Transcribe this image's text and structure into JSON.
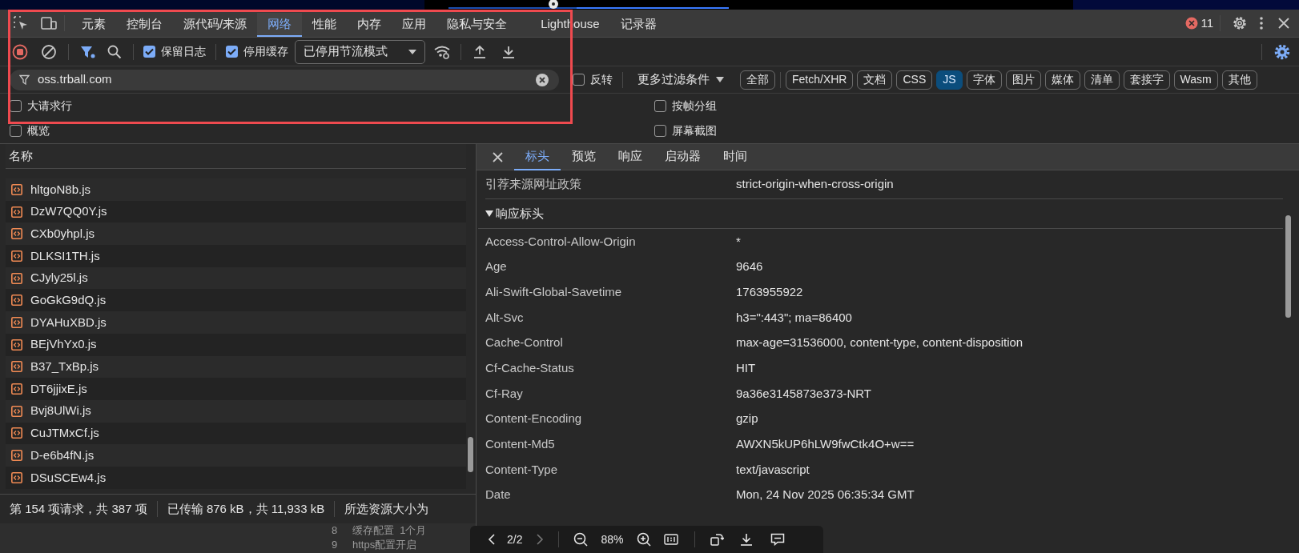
{
  "devtools_tabs": [
    {
      "label": "元素",
      "selected": false
    },
    {
      "label": "控制台",
      "selected": false
    },
    {
      "label": "源代码/来源",
      "selected": false
    },
    {
      "label": "网络",
      "selected": true
    },
    {
      "label": "性能",
      "selected": false
    },
    {
      "label": "内存",
      "selected": false
    },
    {
      "label": "应用",
      "selected": false
    },
    {
      "label": "隐私与安全",
      "selected": false
    },
    {
      "label": "Lighthouse",
      "selected": false
    },
    {
      "label": "记录器",
      "selected": false
    }
  ],
  "error_count": "11",
  "toolbar": {
    "recording": true,
    "checkboxes": [
      {
        "label": "保留日志",
        "checked": true
      },
      {
        "label": "停用缓存",
        "checked": true
      }
    ],
    "throttling": "已停用节流模式"
  },
  "filter": {
    "value": "oss.trball.com"
  },
  "invert": {
    "label": "反转",
    "checked": false
  },
  "more_filters": "更多过滤条件",
  "type_chips": [
    {
      "label": "全部",
      "selected": false
    },
    {
      "label": "Fetch/XHR",
      "selected": false
    },
    {
      "label": "文档",
      "selected": false
    },
    {
      "label": "CSS",
      "selected": false
    },
    {
      "label": "JS",
      "selected": true
    },
    {
      "label": "字体",
      "selected": false
    },
    {
      "label": "图片",
      "selected": false
    },
    {
      "label": "媒体",
      "selected": false
    },
    {
      "label": "清单",
      "selected": false
    },
    {
      "label": "套接字",
      "selected": false
    },
    {
      "label": "Wasm",
      "selected": false
    },
    {
      "label": "其他",
      "selected": false
    }
  ],
  "options": [
    {
      "label": "大请求行",
      "checked": false
    },
    {
      "label": "按帧分组",
      "checked": false
    },
    {
      "label": "概览",
      "checked": false
    },
    {
      "label": "屏幕截图",
      "checked": false
    }
  ],
  "requests": {
    "column": "名称",
    "rows": [
      "hltgoN8b.js",
      "DzW7QQ0Y.js",
      "CXb0yhpl.js",
      "DLKSI1TH.js",
      "CJyly25l.js",
      "GoGkG9dQ.js",
      "DYAHuXBD.js",
      "BEjVhYx0.js",
      "B37_TxBp.js",
      "DT6jjixE.js",
      "Bvj8UlWi.js",
      "CuJTMxCf.js",
      "D-e6b4fN.js",
      "DSuSCEw4.js"
    ]
  },
  "detail_tabs": [
    {
      "label": "标头",
      "selected": true
    },
    {
      "label": "预览",
      "selected": false
    },
    {
      "label": "响应",
      "selected": false
    },
    {
      "label": "启动器",
      "selected": false
    },
    {
      "label": "时间",
      "selected": false
    }
  ],
  "general_rows": [
    {
      "name": "引荐来源网址政策",
      "value": "strict-origin-when-cross-origin"
    }
  ],
  "response_headers": {
    "title": "响应标头",
    "expanded": true,
    "rows": [
      {
        "name": "Access-Control-Allow-Origin",
        "value": "*"
      },
      {
        "name": "Age",
        "value": "9646"
      },
      {
        "name": "Ali-Swift-Global-Savetime",
        "value": "1763955922"
      },
      {
        "name": "Alt-Svc",
        "value": "h3=\":443\"; ma=86400"
      },
      {
        "name": "Cache-Control",
        "value": "max-age=31536000, content-type, content-disposition"
      },
      {
        "name": "Cf-Cache-Status",
        "value": "HIT"
      },
      {
        "name": "Cf-Ray",
        "value": "9a36e3145873e373-NRT"
      },
      {
        "name": "Content-Encoding",
        "value": "gzip"
      },
      {
        "name": "Content-Md5",
        "value": "AWXN5kUP6hLW9fwCtk4O+w=="
      },
      {
        "name": "Content-Type",
        "value": "text/javascript"
      },
      {
        "name": "Date",
        "value": "Mon, 24 Nov 2025 06:35:34 GMT"
      }
    ]
  },
  "status_bar": [
    "第 154 项请求，共 387 项",
    "已传输 876 kB，共 11,933 kB",
    "所选资源大小为"
  ],
  "page_behind": [
    {
      "number": "8",
      "text": "缓存配置  1个月"
    },
    {
      "number": "9",
      "text": "https配置开启"
    }
  ],
  "viewer": {
    "page": "2/2",
    "zoom": "88%"
  }
}
